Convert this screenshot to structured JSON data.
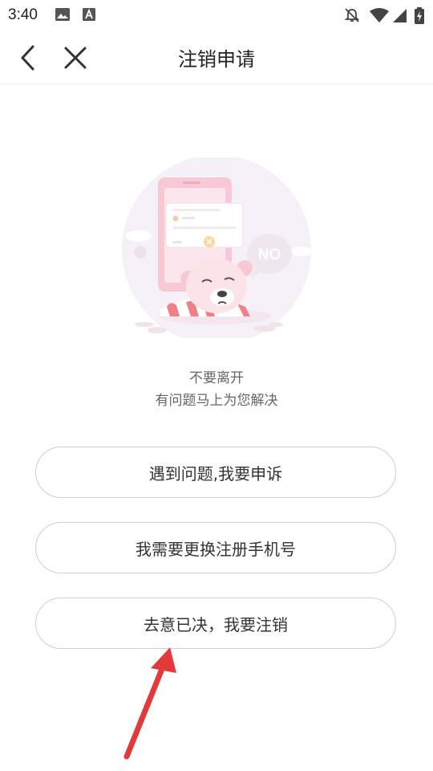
{
  "status_bar": {
    "time": "3:40",
    "icons": [
      "image-icon",
      "a-badge-icon",
      "notifications-off-icon",
      "wifi-icon",
      "signal-icon",
      "battery-charging-icon"
    ]
  },
  "header": {
    "title": "注销申请",
    "back_icon": "chevron-left-icon",
    "close_icon": "close-icon"
  },
  "illustration": {
    "badge_text": "NO"
  },
  "message": {
    "line1": "不要离开",
    "line2": "有问题马上为您解决"
  },
  "options": [
    {
      "label": "遇到问题,我要申诉"
    },
    {
      "label": "我需要更换注册手机号"
    },
    {
      "label": "去意已决，我要注销"
    }
  ],
  "colors": {
    "annotation_arrow": "#e23a3a",
    "button_border": "#cfcfcf"
  }
}
